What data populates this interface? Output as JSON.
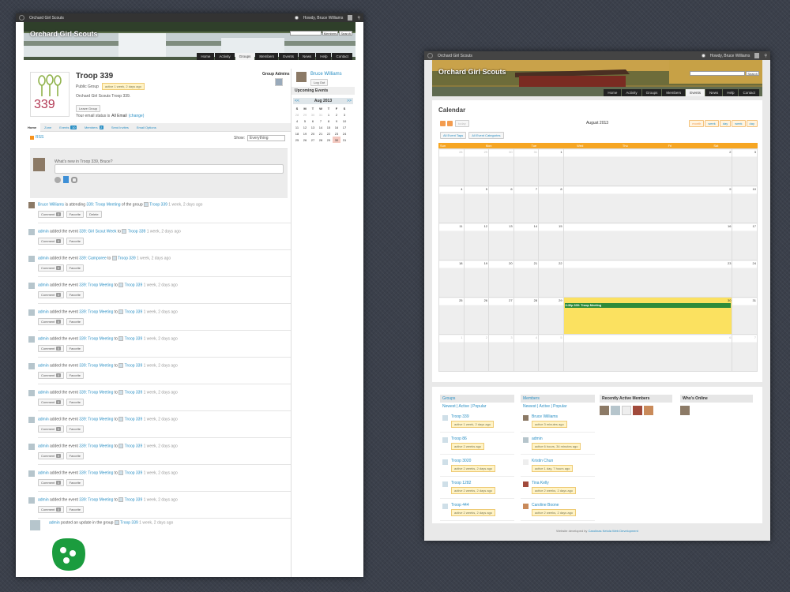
{
  "left": {
    "adminbar": {
      "site": "Orchard Girl Scouts",
      "greeting": "Howdy, Bruce Williams"
    },
    "banner": {
      "title": "Orchard Girl Scouts",
      "search_select": "Members",
      "search_button": "Search"
    },
    "nav": [
      "Home",
      "Activity",
      "Groups",
      "Members",
      "Events",
      "News",
      "Help",
      "Contact"
    ],
    "nav_active": "Groups",
    "group": {
      "name": "Troop 339",
      "type": "Public Group",
      "active": "active 1 week, 2 days ago",
      "description": "Orchard Girl Scouts Troop 339.",
      "leave_button": "Leave Group",
      "email_prefix": "Your email status is",
      "email_value": "All Email",
      "email_change": "(change)",
      "admins_label": "Group Admins",
      "logo_number": "339"
    },
    "tabs": [
      {
        "label": "Home",
        "count": ""
      },
      {
        "label": "Zone",
        "count": ""
      },
      {
        "label": "Events",
        "count": "10"
      },
      {
        "label": "Members",
        "count": "2"
      },
      {
        "label": "Send Invites",
        "count": ""
      },
      {
        "label": "Email Options",
        "count": ""
      }
    ],
    "rss": "RSS",
    "show_label": "Show:",
    "show_value": "Everything",
    "whats_new": "What's new in Troop 339, Bruce?",
    "feed": [
      {
        "actor": "Bruce Williams",
        "text1": "is attending",
        "link1": "339: Troop Meeting",
        "text2": "of the group",
        "link2": "Troop 339",
        "time": "1 week, 2 days ago",
        "buttons": [
          "Comment",
          "Favorite",
          "Delete"
        ],
        "count": "0"
      },
      {
        "actor": "admin",
        "text1": "added the event",
        "link1": "339: Girl Scout Week",
        "text2": "to",
        "link2": "Troop 339",
        "time": "1 week, 2 days ago",
        "buttons": [
          "Comment",
          "Favorite"
        ],
        "count": "0"
      },
      {
        "actor": "admin",
        "text1": "added the event",
        "link1": "339: Camporee",
        "text2": "to",
        "link2": "Troop 339",
        "time": "1 week, 2 days ago",
        "buttons": [
          "Comment",
          "Favorite"
        ],
        "count": "0"
      },
      {
        "actor": "admin",
        "text1": "added the event",
        "link1": "339: Troop Meeting",
        "text2": "to",
        "link2": "Troop 339",
        "time": "1 week, 2 days ago",
        "buttons": [
          "Comment",
          "Favorite"
        ],
        "count": "0"
      },
      {
        "actor": "admin",
        "text1": "added the event",
        "link1": "339: Troop Meeting",
        "text2": "to",
        "link2": "Troop 339",
        "time": "1 week, 2 days ago",
        "buttons": [
          "Comment",
          "Favorite"
        ],
        "count": "0"
      },
      {
        "actor": "admin",
        "text1": "added the event",
        "link1": "339: Troop Meeting",
        "text2": "to",
        "link2": "Troop 339",
        "time": "1 week, 2 days ago",
        "buttons": [
          "Comment",
          "Favorite"
        ],
        "count": "0"
      },
      {
        "actor": "admin",
        "text1": "added the event",
        "link1": "339: Troop Meeting",
        "text2": "to",
        "link2": "Troop 339",
        "time": "1 week, 2 days ago",
        "buttons": [
          "Comment",
          "Favorite"
        ],
        "count": "0"
      },
      {
        "actor": "admin",
        "text1": "added the event",
        "link1": "339: Troop Meeting",
        "text2": "to",
        "link2": "Troop 339",
        "time": "1 week, 2 days ago",
        "buttons": [
          "Comment",
          "Favorite"
        ],
        "count": "0"
      },
      {
        "actor": "admin",
        "text1": "added the event",
        "link1": "339: Troop Meeting",
        "text2": "to",
        "link2": "Troop 339",
        "time": "1 week, 2 days ago",
        "buttons": [
          "Comment",
          "Favorite"
        ],
        "count": "0"
      },
      {
        "actor": "admin",
        "text1": "added the event",
        "link1": "339: Troop Meeting",
        "text2": "to",
        "link2": "Troop 339",
        "time": "1 week, 2 days ago",
        "buttons": [
          "Comment",
          "Favorite"
        ],
        "count": "0"
      },
      {
        "actor": "admin",
        "text1": "added the event",
        "link1": "339: Troop Meeting",
        "text2": "to",
        "link2": "Troop 339",
        "time": "1 week, 2 days ago",
        "buttons": [
          "Comment",
          "Favorite"
        ],
        "count": "0"
      },
      {
        "actor": "admin",
        "text1": "added the event",
        "link1": "339: Troop Meeting",
        "text2": "to",
        "link2": "Troop 339",
        "time": "1 week, 2 days ago",
        "buttons": [
          "Comment",
          "Favorite"
        ],
        "count": "0"
      }
    ],
    "last_feed": {
      "actor": "admin",
      "text1": "posted an update in the group",
      "link2": "Troop 339",
      "time": "1 week, 2 days ago"
    },
    "sidebar": {
      "user": "Bruce Williams",
      "logout": "Log Out",
      "upcoming": "Upcoming Events",
      "month": "Aug 2013",
      "prev": "<<",
      "next": ">>",
      "dow": [
        "S",
        "M",
        "T",
        "W",
        "T",
        "F",
        "S"
      ],
      "weeks": [
        [
          "28",
          "29",
          "30",
          "31",
          "1",
          "2",
          "3"
        ],
        [
          "4",
          "5",
          "6",
          "7",
          "8",
          "9",
          "10"
        ],
        [
          "11",
          "12",
          "13",
          "14",
          "15",
          "16",
          "17"
        ],
        [
          "18",
          "19",
          "20",
          "21",
          "22",
          "23",
          "24"
        ],
        [
          "25",
          "26",
          "27",
          "28",
          "29",
          "30",
          "31"
        ]
      ]
    }
  },
  "right": {
    "adminbar": {
      "site": "Orchard Girl Scouts",
      "greeting": "Howdy, Bruce Williams"
    },
    "banner": {
      "title": "Orchard Girl Scouts",
      "search_button": "Search"
    },
    "nav": [
      "Home",
      "Activity",
      "Groups",
      "Members",
      "Events",
      "News",
      "Help",
      "Contact"
    ],
    "nav_active": "Events",
    "calendar": {
      "heading": "Calendar",
      "today_button": "today",
      "month_title": "August 2013",
      "views": [
        "month",
        "week",
        "day",
        "week",
        "day"
      ],
      "filter_tags": "All Event Tags",
      "filter_categories": "All Event Categories",
      "dow": [
        "Sun",
        "Mon",
        "Tue",
        "Wed",
        "Thu",
        "Fri",
        "Sat"
      ],
      "weeks": [
        [
          "28",
          "29",
          "30",
          "31",
          "1",
          "2",
          "3"
        ],
        [
          "4",
          "5",
          "6",
          "7",
          "8",
          "9",
          "10"
        ],
        [
          "11",
          "12",
          "13",
          "14",
          "15",
          "16",
          "17"
        ],
        [
          "18",
          "19",
          "20",
          "21",
          "22",
          "23",
          "24"
        ],
        [
          "25",
          "26",
          "27",
          "28",
          "29",
          "30",
          "31"
        ],
        [
          "1",
          "2",
          "3",
          "4",
          "5",
          "6",
          "7"
        ]
      ],
      "event": "6:30p 339: Troop Meeting"
    },
    "widgets": {
      "groups": {
        "title": "Groups",
        "filters": "Newest | Active | Popular",
        "items": [
          {
            "name": "Troop 339",
            "active": "active 1 week, 2 days ago"
          },
          {
            "name": "Troop 86",
            "active": "active 2 weeks ago"
          },
          {
            "name": "Troop 3020",
            "active": "active 2 weeks, 2 days ago"
          },
          {
            "name": "Troop 1282",
            "active": "active 2 weeks, 2 days ago"
          },
          {
            "name": "Troop 444",
            "active": "active 2 weeks, 2 days ago"
          }
        ]
      },
      "members": {
        "title": "Members",
        "filters": "Newest | Active | Popular",
        "items": [
          {
            "name": "Bruce Williams",
            "active": "active 3 minutes ago"
          },
          {
            "name": "admin",
            "active": "active 6 hours, 34 minutes ago"
          },
          {
            "name": "Kristin Chun",
            "active": "active 1 day, 7 hours ago"
          },
          {
            "name": "Tina Kelly",
            "active": "active 2 weeks, 2 days ago"
          },
          {
            "name": "Caroline Boone",
            "active": "active 2 weeks, 2 days ago"
          }
        ]
      },
      "recent": {
        "title": "Recently Active Members"
      },
      "online": {
        "title": "Who's Online"
      }
    },
    "footer": {
      "prefix": "Website developed by",
      "link": "Carolinas Ketola Web Development"
    }
  }
}
